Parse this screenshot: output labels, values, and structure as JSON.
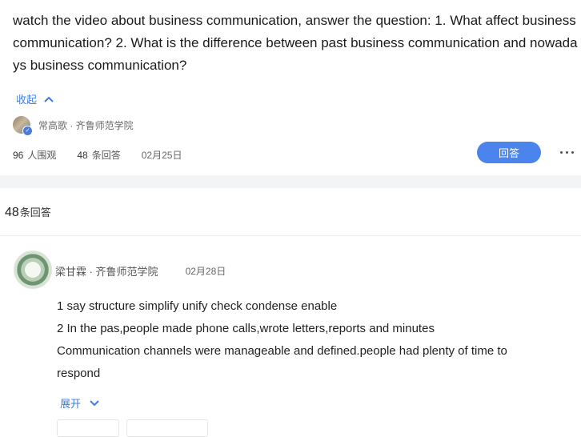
{
  "question": {
    "text": "watch the video about business communication, answer the question: 1. What affect business communication? 2. What is the difference between past business communication and nowadays business communication?",
    "collapse_label": "收起",
    "author": "常高歌 · 齐鲁师范学院",
    "views_count": "96",
    "views_label": "人围观",
    "answers_count": "48",
    "answers_label": "条回答",
    "date": "02月25日",
    "answer_button": "回答"
  },
  "answers_section": {
    "count": "48",
    "label": "条回答"
  },
  "answer": {
    "author": "梁甘霖 · 齐鲁师范学院",
    "date": "02月28日",
    "lines": [
      "1 say structure simplify unify check condense enable",
      "2 In the pas,people made phone calls,wrote letters,reports and minutes",
      "Communication channels were manageable and defined.people had plenty of time to respond"
    ],
    "expand_label": "展开"
  },
  "colors": {
    "accent": "#4a84ec",
    "link": "#3e7de0",
    "section_gap": "#f3f4f6"
  },
  "icons": [
    "chevron-up-icon",
    "chevron-down-icon",
    "more-dots-icon",
    "verified-badge-icon"
  ]
}
